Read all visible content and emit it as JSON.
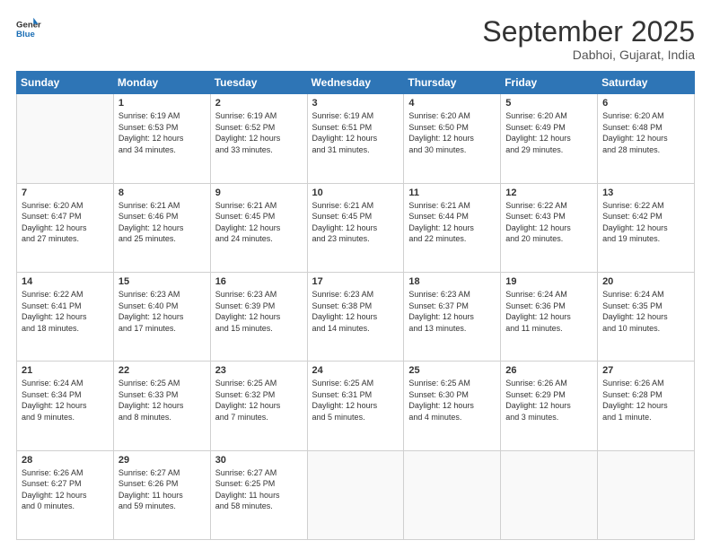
{
  "logo": {
    "line1": "General",
    "line2": "Blue"
  },
  "header": {
    "title": "September 2025",
    "subtitle": "Dabhoi, Gujarat, India"
  },
  "days": [
    "Sunday",
    "Monday",
    "Tuesday",
    "Wednesday",
    "Thursday",
    "Friday",
    "Saturday"
  ],
  "weeks": [
    [
      {
        "day": "",
        "content": ""
      },
      {
        "day": "1",
        "content": "Sunrise: 6:19 AM\nSunset: 6:53 PM\nDaylight: 12 hours\nand 34 minutes."
      },
      {
        "day": "2",
        "content": "Sunrise: 6:19 AM\nSunset: 6:52 PM\nDaylight: 12 hours\nand 33 minutes."
      },
      {
        "day": "3",
        "content": "Sunrise: 6:19 AM\nSunset: 6:51 PM\nDaylight: 12 hours\nand 31 minutes."
      },
      {
        "day": "4",
        "content": "Sunrise: 6:20 AM\nSunset: 6:50 PM\nDaylight: 12 hours\nand 30 minutes."
      },
      {
        "day": "5",
        "content": "Sunrise: 6:20 AM\nSunset: 6:49 PM\nDaylight: 12 hours\nand 29 minutes."
      },
      {
        "day": "6",
        "content": "Sunrise: 6:20 AM\nSunset: 6:48 PM\nDaylight: 12 hours\nand 28 minutes."
      }
    ],
    [
      {
        "day": "7",
        "content": "Sunrise: 6:20 AM\nSunset: 6:47 PM\nDaylight: 12 hours\nand 27 minutes."
      },
      {
        "day": "8",
        "content": "Sunrise: 6:21 AM\nSunset: 6:46 PM\nDaylight: 12 hours\nand 25 minutes."
      },
      {
        "day": "9",
        "content": "Sunrise: 6:21 AM\nSunset: 6:45 PM\nDaylight: 12 hours\nand 24 minutes."
      },
      {
        "day": "10",
        "content": "Sunrise: 6:21 AM\nSunset: 6:45 PM\nDaylight: 12 hours\nand 23 minutes."
      },
      {
        "day": "11",
        "content": "Sunrise: 6:21 AM\nSunset: 6:44 PM\nDaylight: 12 hours\nand 22 minutes."
      },
      {
        "day": "12",
        "content": "Sunrise: 6:22 AM\nSunset: 6:43 PM\nDaylight: 12 hours\nand 20 minutes."
      },
      {
        "day": "13",
        "content": "Sunrise: 6:22 AM\nSunset: 6:42 PM\nDaylight: 12 hours\nand 19 minutes."
      }
    ],
    [
      {
        "day": "14",
        "content": "Sunrise: 6:22 AM\nSunset: 6:41 PM\nDaylight: 12 hours\nand 18 minutes."
      },
      {
        "day": "15",
        "content": "Sunrise: 6:23 AM\nSunset: 6:40 PM\nDaylight: 12 hours\nand 17 minutes."
      },
      {
        "day": "16",
        "content": "Sunrise: 6:23 AM\nSunset: 6:39 PM\nDaylight: 12 hours\nand 15 minutes."
      },
      {
        "day": "17",
        "content": "Sunrise: 6:23 AM\nSunset: 6:38 PM\nDaylight: 12 hours\nand 14 minutes."
      },
      {
        "day": "18",
        "content": "Sunrise: 6:23 AM\nSunset: 6:37 PM\nDaylight: 12 hours\nand 13 minutes."
      },
      {
        "day": "19",
        "content": "Sunrise: 6:24 AM\nSunset: 6:36 PM\nDaylight: 12 hours\nand 11 minutes."
      },
      {
        "day": "20",
        "content": "Sunrise: 6:24 AM\nSunset: 6:35 PM\nDaylight: 12 hours\nand 10 minutes."
      }
    ],
    [
      {
        "day": "21",
        "content": "Sunrise: 6:24 AM\nSunset: 6:34 PM\nDaylight: 12 hours\nand 9 minutes."
      },
      {
        "day": "22",
        "content": "Sunrise: 6:25 AM\nSunset: 6:33 PM\nDaylight: 12 hours\nand 8 minutes."
      },
      {
        "day": "23",
        "content": "Sunrise: 6:25 AM\nSunset: 6:32 PM\nDaylight: 12 hours\nand 7 minutes."
      },
      {
        "day": "24",
        "content": "Sunrise: 6:25 AM\nSunset: 6:31 PM\nDaylight: 12 hours\nand 5 minutes."
      },
      {
        "day": "25",
        "content": "Sunrise: 6:25 AM\nSunset: 6:30 PM\nDaylight: 12 hours\nand 4 minutes."
      },
      {
        "day": "26",
        "content": "Sunrise: 6:26 AM\nSunset: 6:29 PM\nDaylight: 12 hours\nand 3 minutes."
      },
      {
        "day": "27",
        "content": "Sunrise: 6:26 AM\nSunset: 6:28 PM\nDaylight: 12 hours\nand 1 minute."
      }
    ],
    [
      {
        "day": "28",
        "content": "Sunrise: 6:26 AM\nSunset: 6:27 PM\nDaylight: 12 hours\nand 0 minutes."
      },
      {
        "day": "29",
        "content": "Sunrise: 6:27 AM\nSunset: 6:26 PM\nDaylight: 11 hours\nand 59 minutes."
      },
      {
        "day": "30",
        "content": "Sunrise: 6:27 AM\nSunset: 6:25 PM\nDaylight: 11 hours\nand 58 minutes."
      },
      {
        "day": "",
        "content": ""
      },
      {
        "day": "",
        "content": ""
      },
      {
        "day": "",
        "content": ""
      },
      {
        "day": "",
        "content": ""
      }
    ]
  ]
}
